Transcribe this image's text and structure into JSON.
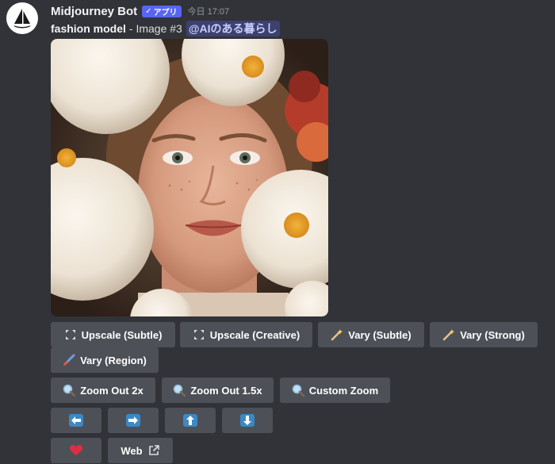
{
  "message": {
    "author": "Midjourney Bot",
    "badge": "アプリ",
    "timestamp": "今日 17:07",
    "prompt_bold": "fashion model",
    "prompt_rest": "- Image #3",
    "mention": "@AIのある暮らし"
  },
  "image": {
    "alt": "portrait of a woman with freckles framed by white peonies and red flowers"
  },
  "buttons": {
    "upscale_subtle": "Upscale (Subtle)",
    "upscale_creative": "Upscale (Creative)",
    "vary_subtle": "Vary (Subtle)",
    "vary_strong": "Vary (Strong)",
    "vary_region": "Vary (Region)",
    "zoom_out_2x": "Zoom Out 2x",
    "zoom_out_1_5x": "Zoom Out 1.5x",
    "custom_zoom": "Custom Zoom",
    "web": "Web"
  },
  "icons": {
    "upscale": "expand-arrows-icon",
    "vary": "magic-wand-icon",
    "vary_region": "paintbrush-icon",
    "zoom": "magnifier-icon",
    "pan_left": "arrow-left-icon",
    "pan_right": "arrow-right-icon",
    "pan_up": "arrow-up-icon",
    "pan_down": "arrow-down-icon",
    "favorite": "heart-icon",
    "external": "external-link-icon"
  },
  "colors": {
    "background": "#313338",
    "button": "#4e5058",
    "badge": "#5865f2",
    "arrow_blue": "#3b88c3",
    "heart": "#dd2e44"
  }
}
